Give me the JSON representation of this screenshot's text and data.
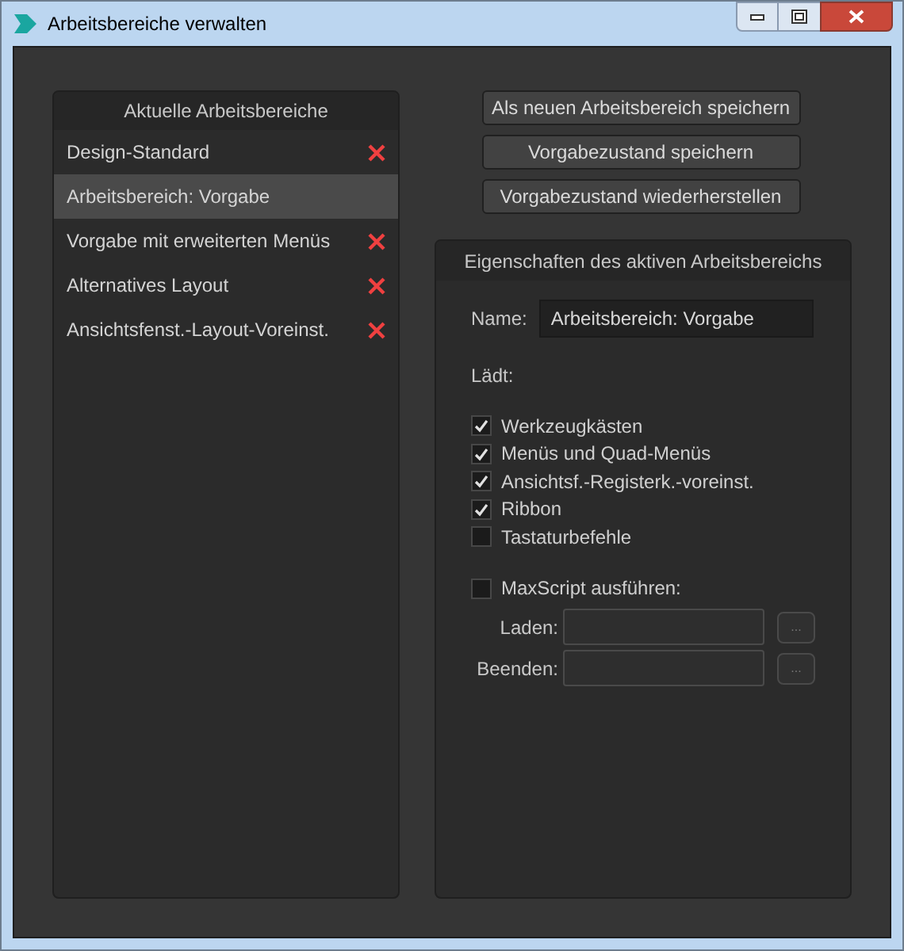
{
  "window": {
    "title": "Arbeitsbereiche verwalten"
  },
  "workspaces": {
    "title": "Aktuelle Arbeitsbereiche",
    "items": [
      {
        "label": "Design-Standard",
        "selected": false,
        "deletable": true
      },
      {
        "label": "Arbeitsbereich: Vorgabe",
        "selected": true,
        "deletable": false
      },
      {
        "label": "Vorgabe mit erweiterten Menüs",
        "selected": false,
        "deletable": true
      },
      {
        "label": "Alternatives Layout",
        "selected": false,
        "deletable": true
      },
      {
        "label": "Ansichtsfenst.-Layout-Voreinst.",
        "selected": false,
        "deletable": true
      }
    ]
  },
  "buttons": [
    "Als neuen Arbeitsbereich speichern",
    "Vorgabezustand speichern",
    "Vorgabezustand wiederherstellen"
  ],
  "properties": {
    "title": "Eigenschaften des aktiven Arbeitsbereichs",
    "name_label": "Name:",
    "name_value": "Arbeitsbereich: Vorgabe",
    "loads_label": "Lädt:",
    "loads": [
      {
        "label": "Werkzeugkästen",
        "checked": true
      },
      {
        "label": "Menüs und Quad-Menüs",
        "checked": true
      },
      {
        "label": "Ansichtsf.-Registerk.-voreinst.",
        "checked": true
      },
      {
        "label": "Ribbon",
        "checked": true
      },
      {
        "label": "Tastaturbefehle",
        "checked": false
      }
    ],
    "maxscript": {
      "label": "MaxScript ausführen:",
      "checked": false
    },
    "scripts": [
      {
        "label": "Laden:",
        "browse": "..."
      },
      {
        "label": "Beenden:",
        "browse": "..."
      }
    ]
  }
}
